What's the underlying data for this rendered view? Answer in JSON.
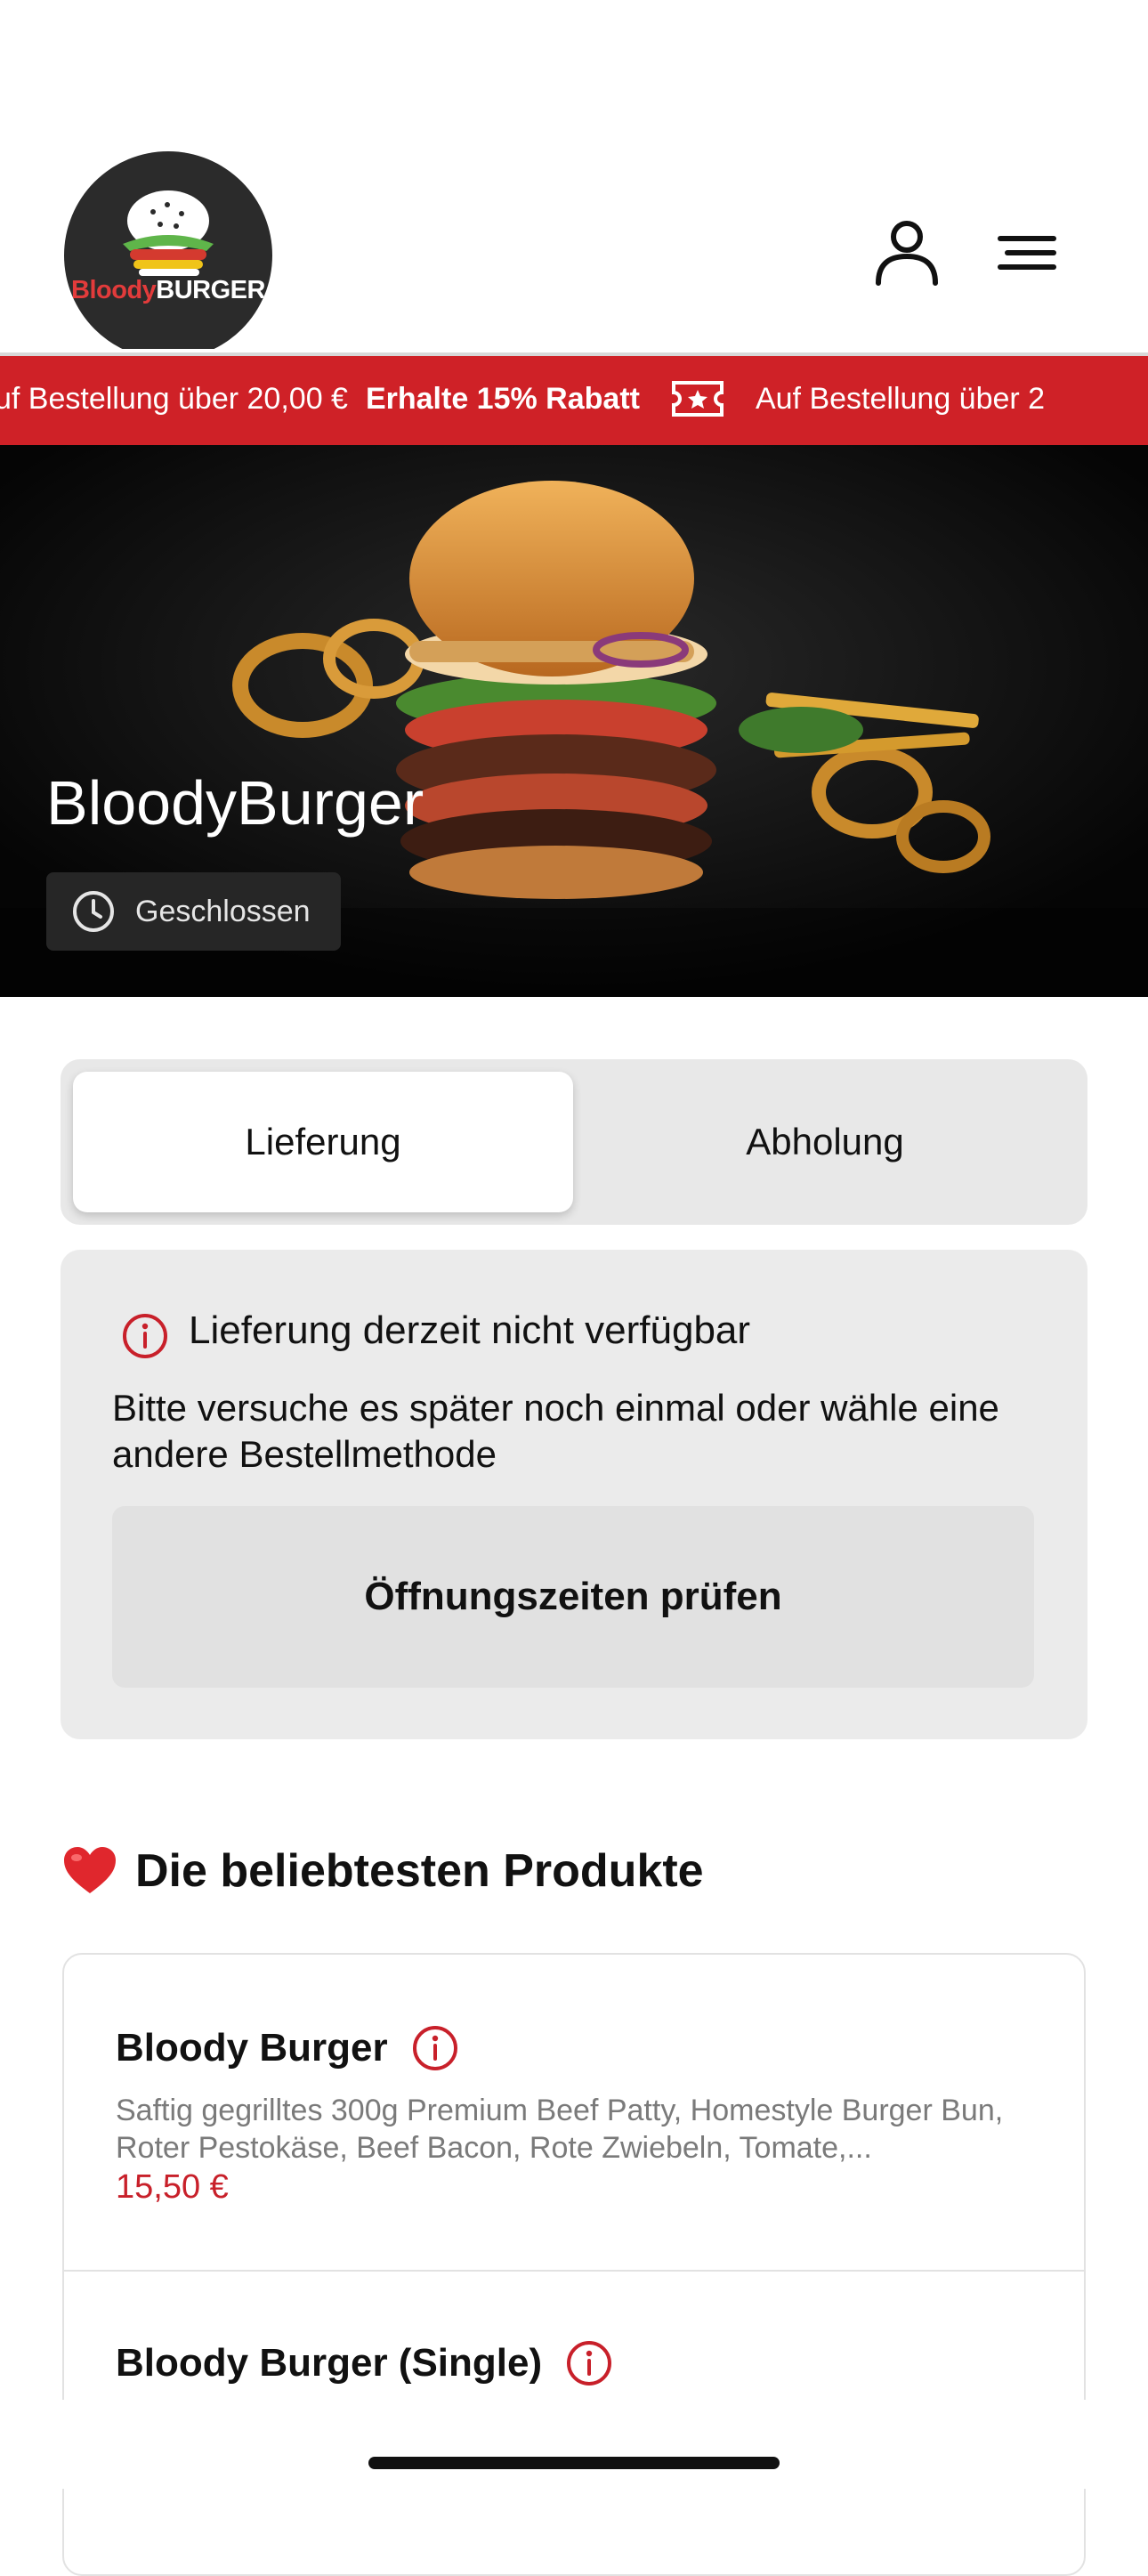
{
  "brand": {
    "logo_text_1": "Bloody",
    "logo_text_2": "BURGER",
    "accent": "#cf2127"
  },
  "header": {
    "account_icon": "user-icon",
    "menu_icon": "menu-icon"
  },
  "promo": {
    "text": "uf Bestellung über 20,00 €",
    "bold": "Erhalte 15% Rabatt",
    "text_repeat": "Auf Bestellung über 2",
    "icon": "ticket-icon"
  },
  "hero": {
    "title": "BloodyBurger",
    "status": "Geschlossen",
    "status_icon": "clock-icon"
  },
  "order_mode": {
    "options": [
      "Lieferung",
      "Abholung"
    ],
    "selected": "Lieferung"
  },
  "notice": {
    "icon": "info-icon",
    "title": "Lieferung derzeit nicht verfügbar",
    "text": "Bitte versuche es später noch einmal oder wähle eine andere Bestellmethode",
    "button": "Öffnungszeiten prüfen"
  },
  "popular": {
    "title": "Die beliebtesten Produkte",
    "icon": "heart-icon",
    "products": [
      {
        "name": "Bloody Burger",
        "description": "Saftig gegrilltes 300g Premium Beef Patty, Homestyle Burger Bun, Roter Pestokäse, Beef Bacon, Rote Zwiebeln, Tomate,...",
        "price": "15,50 €"
      },
      {
        "name": "Bloody Burger (Single)"
      }
    ]
  }
}
